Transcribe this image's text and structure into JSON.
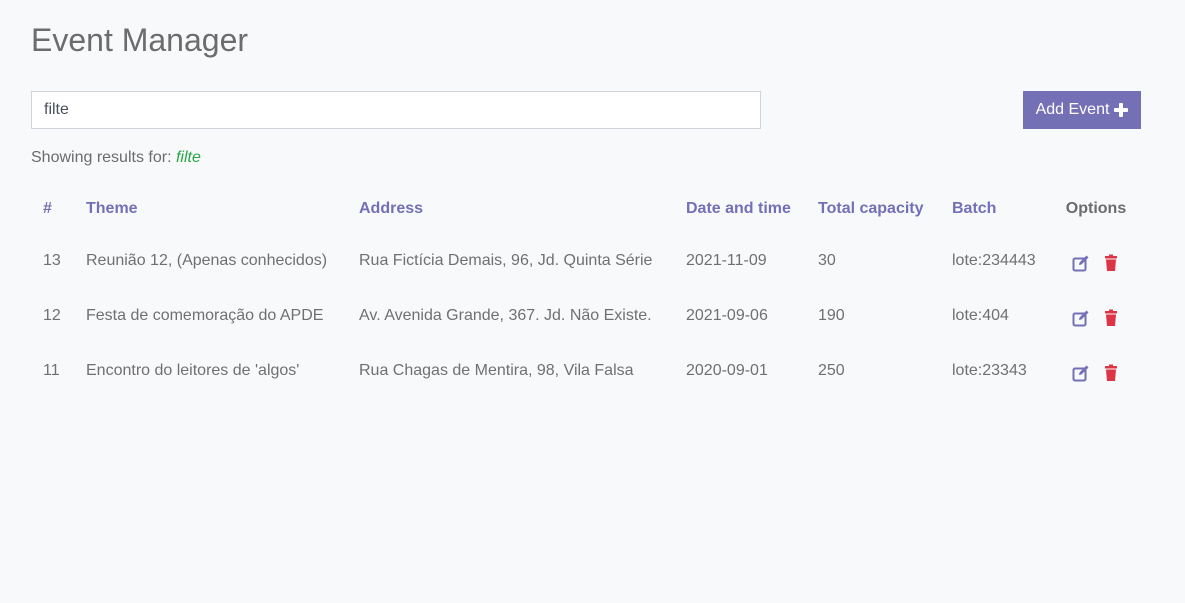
{
  "header": {
    "title": "Event Manager"
  },
  "search": {
    "value": "filte",
    "placeholder": ""
  },
  "toolbar": {
    "add_label": "Add Event"
  },
  "results": {
    "prefix": "Showing results for:",
    "term": "filte"
  },
  "table": {
    "columns": {
      "id": "#",
      "theme": "Theme",
      "address": "Address",
      "date": "Date and time",
      "capacity": "Total capacity",
      "batch": "Batch",
      "options": "Options"
    },
    "rows": [
      {
        "id": "13",
        "theme": "Reunião 12, (Apenas conhecidos)",
        "address": "Rua Fictícia Demais, 96, Jd. Quinta Série",
        "date": "2021-11-09",
        "capacity": "30",
        "batch": "lote:234443"
      },
      {
        "id": "12",
        "theme": "Festa de comemoração do APDE",
        "address": "Av. Avenida Grande, 367. Jd. Não Existe.",
        "date": "2021-09-06",
        "capacity": "190",
        "batch": "lote:404"
      },
      {
        "id": "11",
        "theme": "Encontro do leitores de 'algos'",
        "address": "Rua Chagas de Mentira, 98, Vila Falsa",
        "date": "2020-09-01",
        "capacity": "250",
        "batch": "lote:23343"
      }
    ]
  },
  "icons": {
    "add": "plus-icon",
    "edit": "edit-icon",
    "delete": "trash-icon"
  },
  "colors": {
    "accent": "#7470b6",
    "danger": "#dc3545",
    "success": "#28a745",
    "text": "#707070"
  }
}
